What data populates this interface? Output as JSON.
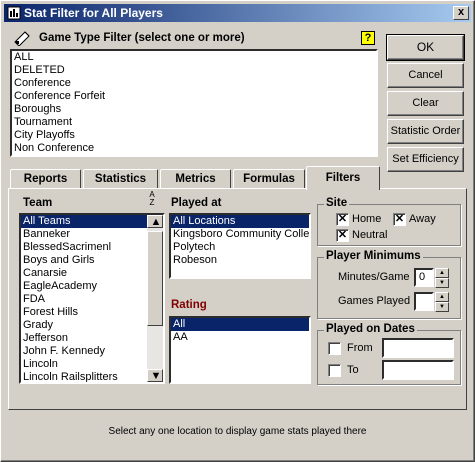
{
  "window": {
    "title": "Stat Filter for All Players",
    "close_label": "x"
  },
  "game_type": {
    "label": "Game Type Filter (select one or more)",
    "help_label": "?",
    "items": [
      "ALL",
      "DELETED",
      "Conference",
      "Conference Forfeit",
      "Boroughs",
      "Tournament",
      "City Playoffs",
      "Non Conference"
    ]
  },
  "buttons": {
    "ok": "OK",
    "cancel": "Cancel",
    "clear": "Clear",
    "stat_order": "Statistic Order",
    "set_efficiency": "Set Efficiency"
  },
  "tabs": [
    "Reports",
    "Statistics",
    "Metrics",
    "Formulas",
    "Filters"
  ],
  "active_tab": "Filters",
  "team": {
    "label": "Team",
    "sort_label": "A Z",
    "items": [
      "All Teams",
      "Banneker",
      "BlessedSacrimenl",
      "Boys and Girls",
      "Canarsie",
      "EagleAcademy",
      "FDA",
      "Forest Hills",
      "Grady",
      "Jefferson",
      "John F. Kennedy",
      "Lincoln",
      "Lincoln Railsplitters"
    ],
    "selected": "All Teams"
  },
  "played_at": {
    "label": "Played at",
    "items": [
      "All Locations",
      "Kingsboro Community College",
      "Polytech",
      "Robeson"
    ],
    "selected": "All Locations"
  },
  "rating": {
    "label": "Rating",
    "color": "#800000",
    "items": [
      "All",
      "AA"
    ],
    "selected": "All"
  },
  "site": {
    "label": "Site",
    "home": {
      "label": "Home",
      "checked": true
    },
    "away": {
      "label": "Away",
      "checked": true
    },
    "neutral": {
      "label": "Neutral",
      "checked": true
    }
  },
  "player_minimums": {
    "label": "Player Minimums",
    "minutes_label": "Minutes/Game",
    "minutes_value": "0",
    "games_label": "Games Played",
    "games_value": ""
  },
  "played_on_dates": {
    "label": "Played on Dates",
    "from_label": "From",
    "to_label": "To",
    "from_value": "",
    "to_value": ""
  },
  "status_text": "Select any one location to display game stats played there",
  "colors": {
    "selection": "#0a246a",
    "title_start": "#0a246a",
    "help_bg": "#ffff00"
  }
}
